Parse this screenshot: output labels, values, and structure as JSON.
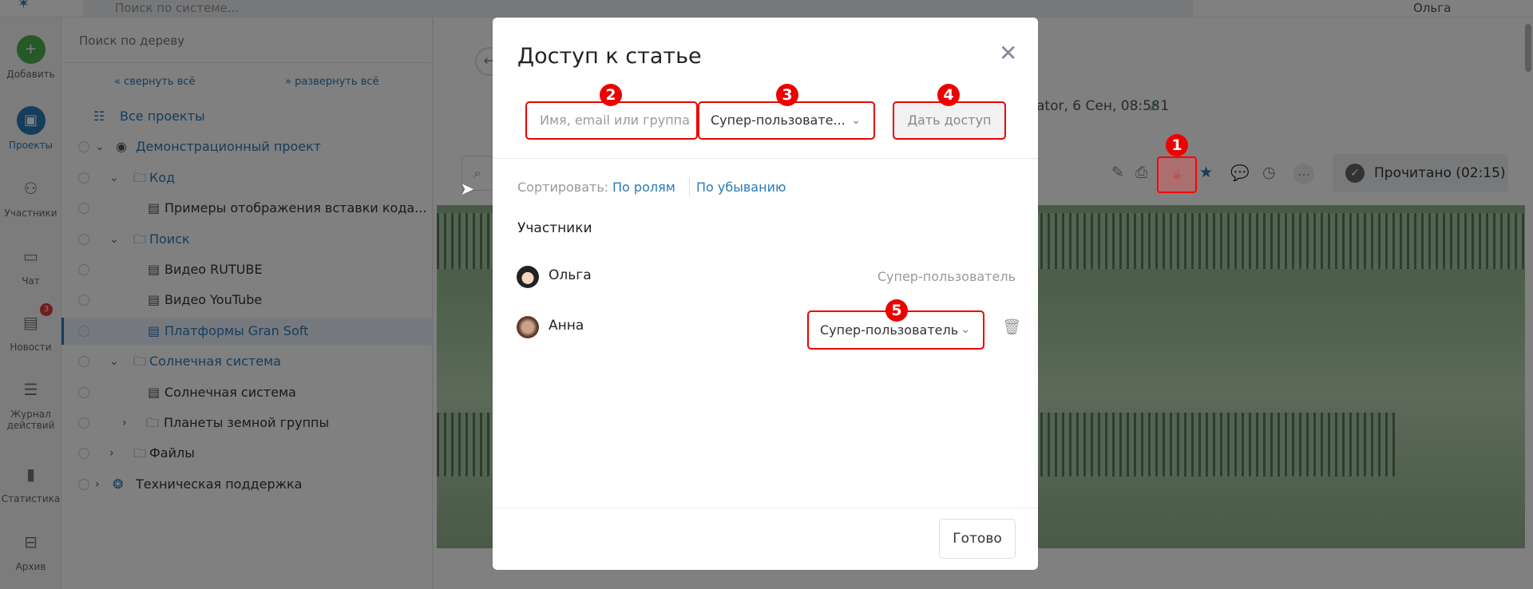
{
  "header": {
    "search_placeholder": "Поиск по системе...",
    "user_name": "Ольга"
  },
  "nav": {
    "items": [
      {
        "label": "Добавить",
        "icon": "plus-icon"
      },
      {
        "label": "Проекты",
        "icon": "briefcase-icon"
      },
      {
        "label": "Участники",
        "icon": "users-icon"
      },
      {
        "label": "Чат",
        "icon": "chat-icon"
      },
      {
        "label": "Новости",
        "icon": "news-icon",
        "badge": "3"
      },
      {
        "label": "Журнал действий",
        "icon": "journal-icon"
      },
      {
        "label": "Статистика",
        "icon": "chart-icon"
      },
      {
        "label": "Архив",
        "icon": "archive-icon"
      }
    ]
  },
  "tree": {
    "search_placeholder": "Поиск по дереву",
    "collapse_all": "свернуть всё",
    "expand_all": "развернуть всё",
    "all_projects": "Все проекты",
    "rows": [
      "Демонстрационный проект",
      "Код",
      "Примеры отображения вставки кода...",
      "Поиск",
      "Видео RUTUBE",
      "Видео YouTube",
      "Платформы Gran Soft",
      "Солнечная система",
      "Солнечная система",
      "Планеты земной группы",
      "Файлы",
      "Техническая поддержка"
    ]
  },
  "article": {
    "meta": "ator, 6 Сен, 08:58",
    "viewers": "1",
    "read_label": "Прочитано (02:15)"
  },
  "modal": {
    "title": "Доступ к статье",
    "input_placeholder": "Имя, email или группа",
    "role_select": "Супер-пользовате...",
    "give_button": "Дать доступ",
    "sort_label": "Сортировать:",
    "sort_by_roles": "По ролям",
    "sort_desc": "По убыванию",
    "participants_heading": "Участники",
    "participants": [
      {
        "name": "Ольга",
        "role": "Супер-пользователь"
      },
      {
        "name": "Анна",
        "role": "Супер-пользователь"
      }
    ],
    "done_button": "Готово"
  },
  "annotations": [
    "1",
    "2",
    "3",
    "4",
    "5"
  ],
  "colors": {
    "accent": "#2a7ab8",
    "annotation": "#e00000",
    "add": "#4caf50"
  }
}
